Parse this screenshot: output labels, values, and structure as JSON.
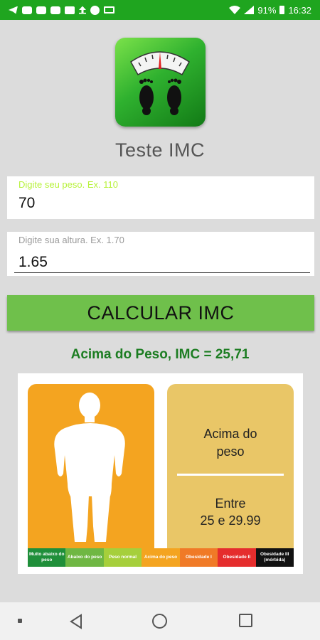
{
  "status_bar": {
    "battery": "91%",
    "time": "16:32",
    "left_icons": [
      "telegram-icon",
      "youtube-icon",
      "youtube-icon",
      "youtube-icon",
      "mail-icon",
      "upload-icon",
      "check-icon",
      "laptop-icon"
    ],
    "right_icons": [
      "wifi-icon",
      "signal-icon",
      "battery-icon"
    ]
  },
  "app": {
    "title": "Teste IMC",
    "logo_icon": "bathroom-scale-icon"
  },
  "form": {
    "weight": {
      "label": "Digite seu peso. Ex. 110",
      "value": "70"
    },
    "height": {
      "label": "Digite sua altura. Ex. 1.70",
      "value": "1.65"
    },
    "button_label": "CALCULAR IMC"
  },
  "result": {
    "text": "Acima do Peso, IMC = 25,71",
    "category_line1": "Acima do",
    "category_line2": "peso",
    "range_line1": "Entre",
    "range_line2": "25 e 29.99",
    "figure_icon": "body-silhouette-icon"
  },
  "scale": [
    {
      "label": "Muito abaixo do peso",
      "color": "#1f8f3a"
    },
    {
      "label": "Abaixo do peso",
      "color": "#6fb743"
    },
    {
      "label": "Peso normal",
      "color": "#a6cf3b"
    },
    {
      "label": "Acima do peso",
      "color": "#f4a420"
    },
    {
      "label": "Obesidade I",
      "color": "#f07a27"
    },
    {
      "label": "Obesidade II",
      "color": "#e52d2d"
    },
    {
      "label": "Obesidade III (mórbida)",
      "color": "#111111"
    }
  ],
  "colors": {
    "status_bar": "#1fa51f",
    "button": "#6fc04b",
    "result_text": "#1c7d22",
    "figure_panel": "#f4a420",
    "info_panel": "#e9c667"
  },
  "nav": [
    "back-icon",
    "home-icon",
    "recents-icon"
  ]
}
